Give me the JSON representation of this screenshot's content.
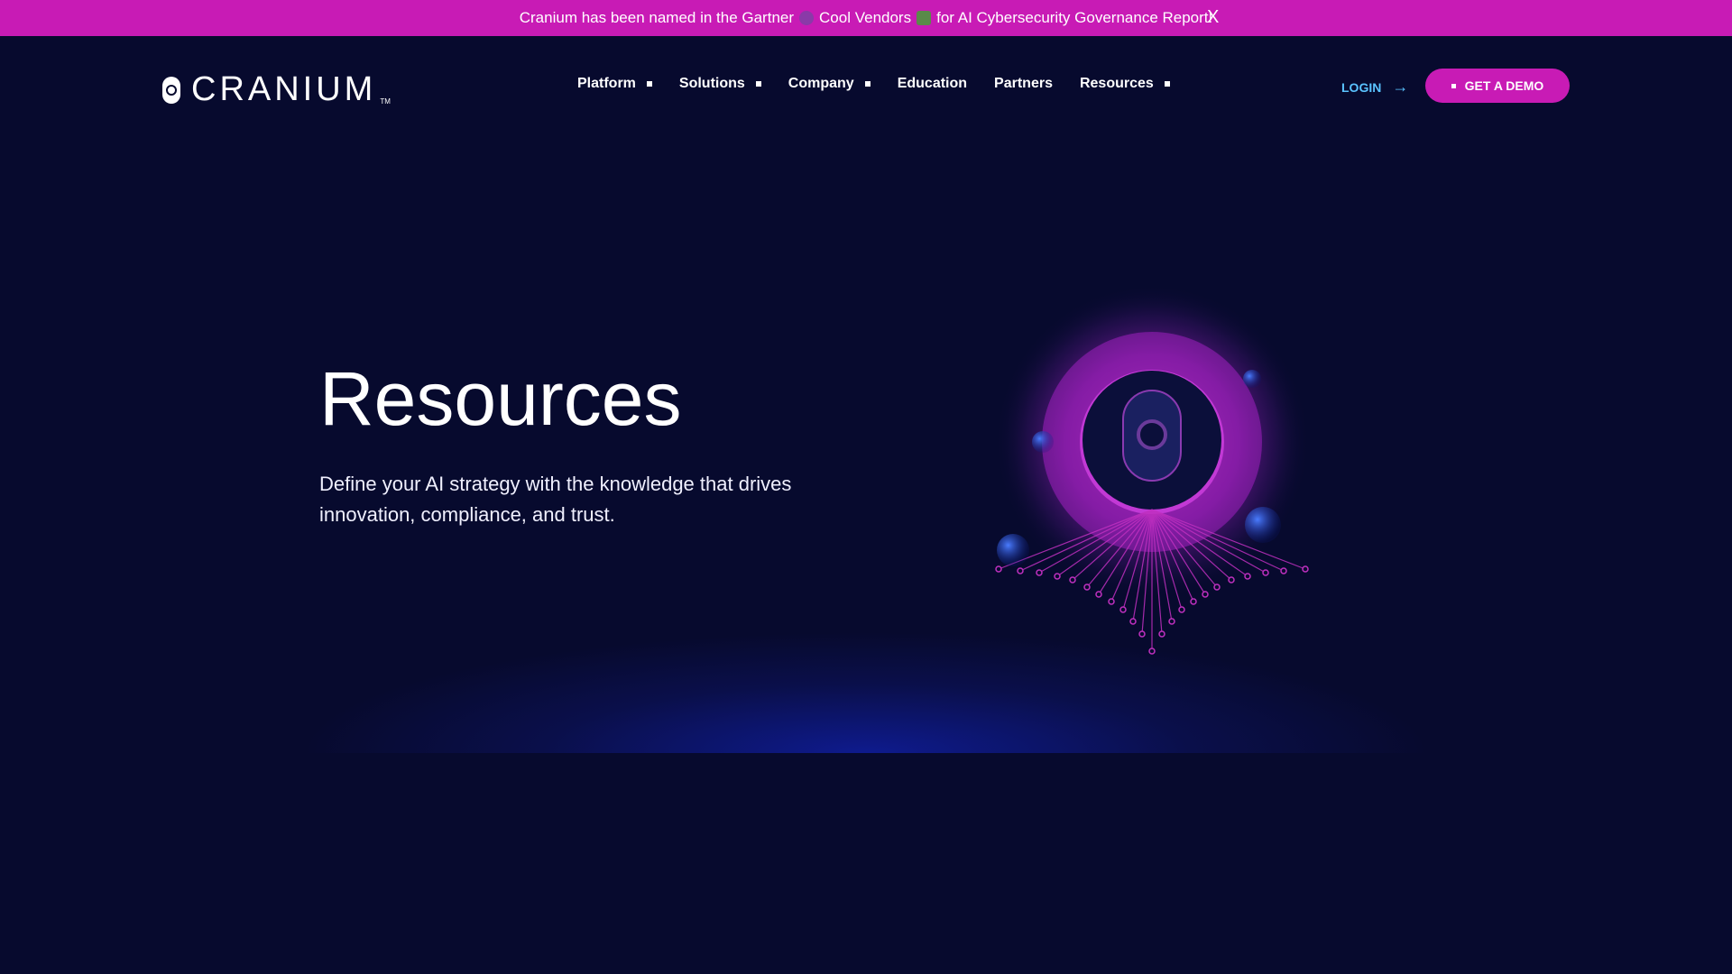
{
  "announcement": {
    "text_before": "Cranium has been named in the Gartner",
    "text_middle": "Cool Vendors",
    "text_after": "for AI Cybersecurity Governance Report!",
    "close_label": "X"
  },
  "brand": {
    "name": "CRANIUM",
    "tm": "TM",
    "logo_icon": "cranium-logo-icon"
  },
  "nav": {
    "items": [
      {
        "label": "Platform",
        "has_dropdown": true
      },
      {
        "label": "Solutions",
        "has_dropdown": true
      },
      {
        "label": "Company",
        "has_dropdown": true
      },
      {
        "label": "Education",
        "has_dropdown": false
      },
      {
        "label": "Partners",
        "has_dropdown": false
      },
      {
        "label": "Resources",
        "has_dropdown": true
      }
    ],
    "login_label": "LOGIN",
    "login_icon": "arrow-right-icon",
    "demo_label": "GET A DEMO"
  },
  "hero": {
    "title": "Resources",
    "subtitle": "Define your AI strategy with the knowledge that drives innovation, compliance, and trust."
  },
  "colors": {
    "background": "#070a2e",
    "accent": "#c81bb5",
    "login": "#5ac3ff",
    "glow": "#1428dc"
  }
}
